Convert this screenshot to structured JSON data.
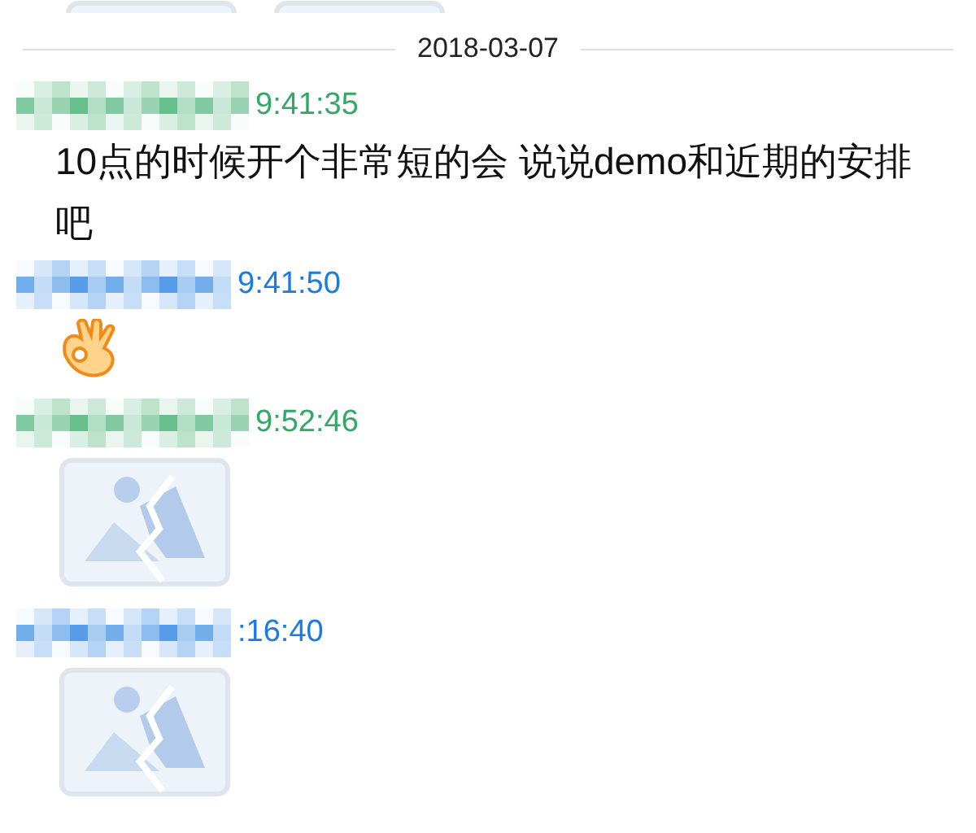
{
  "earlier_images": [
    {
      "kind": "image"
    },
    {
      "kind": "image"
    }
  ],
  "date": "2018-03-07",
  "messages": [
    {
      "color": "#33a866",
      "time": "9:41:35",
      "kind": "text",
      "text": "10点的时候开个非常短的会 说说demo和近期的安排吧"
    },
    {
      "color": "#1c7ae0",
      "time": "9:41:50",
      "kind": "emoji"
    },
    {
      "color": "#33a866",
      "time": "9:52:46",
      "kind": "image"
    },
    {
      "color": "#1c7ae0",
      "time": ":16:40",
      "kind": "image"
    }
  ]
}
